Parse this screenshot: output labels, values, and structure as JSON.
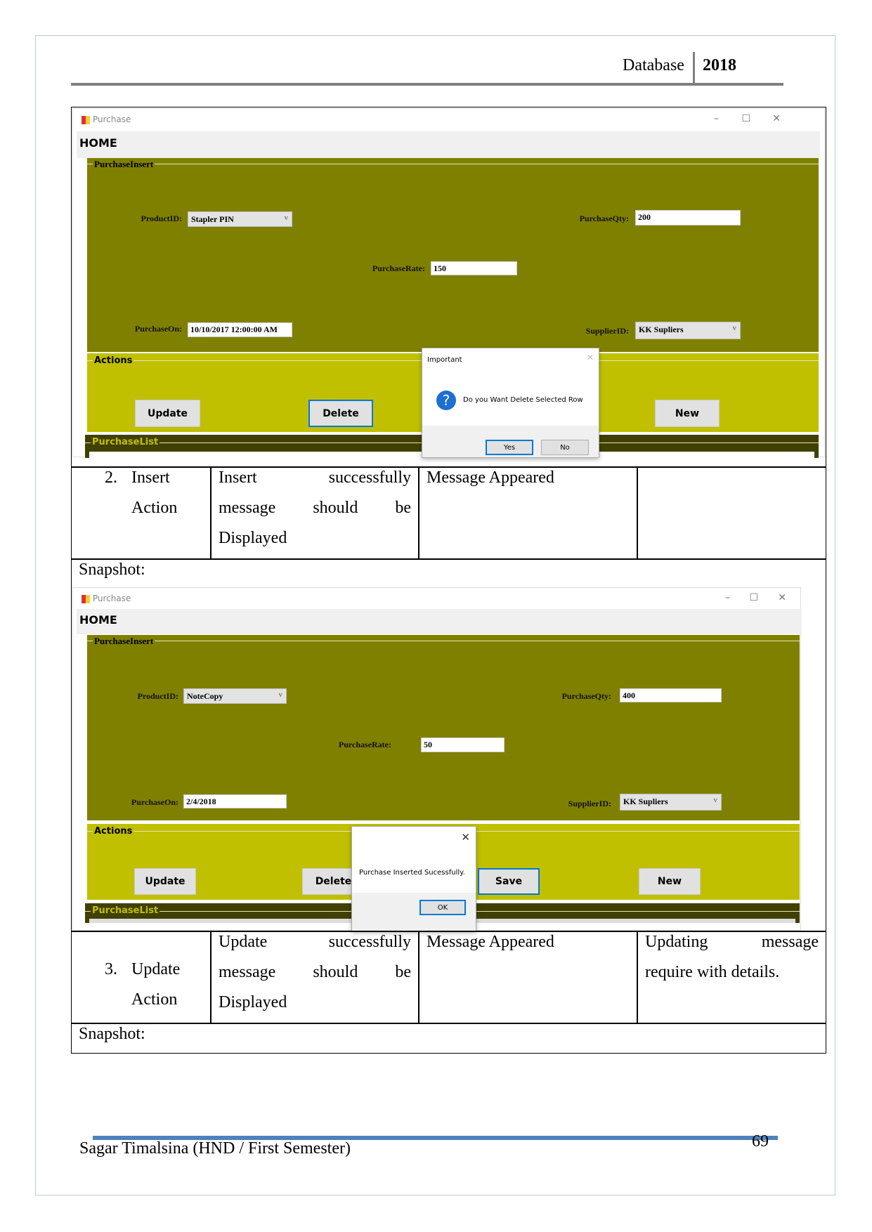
{
  "header": {
    "subject": "Database",
    "year": "2018"
  },
  "screens": [
    {
      "title": "Purchase",
      "home": "HOME",
      "group_insert": "PurchaseInsert",
      "group_actions": "Actions",
      "group_list": "PurchaseList",
      "labels": {
        "product": "ProductID:",
        "qty": "PurchaseQty:",
        "rate": "PurchaseRate:",
        "on": "PurchaseOn:",
        "supplier": "SupplierID:"
      },
      "values": {
        "product": "Stapler PIN",
        "qty": "200",
        "rate": "150",
        "on": "10/10/2017 12:00:00 AM",
        "supplier": "KK Supliers"
      },
      "buttons": {
        "update": "Update",
        "delete": "Delete",
        "new": "New"
      },
      "dialog": {
        "title": "Important",
        "message": "Do you Want Delete Selected Row",
        "yes": "Yes",
        "no": "No"
      }
    },
    {
      "title": "Purchase",
      "home": "HOME",
      "group_insert": "PurchaseInsert",
      "group_actions": "Actions",
      "group_list": "PurchaseList",
      "labels": {
        "product": "ProductID:",
        "qty": "PurchaseQty:",
        "rate": "PurchaseRate:",
        "on": "PurchaseOn:",
        "supplier": "SupplierID:"
      },
      "values": {
        "product": "NoteCopy",
        "qty": "400",
        "rate": "50",
        "on": "2/4/2018",
        "supplier": "KK Supliers"
      },
      "buttons": {
        "update": "Update",
        "delete": "Delete",
        "save": "Save",
        "new": "New"
      },
      "dialog": {
        "message": "Purchase Inserted Sucessfully.",
        "ok": "OK"
      }
    }
  ],
  "rows": [
    {
      "num": "2.",
      "test": [
        "Insert",
        "Action"
      ],
      "expected": [
        [
          "Insert",
          "successfully"
        ],
        [
          "message",
          "should",
          "be"
        ],
        [
          "Displayed"
        ]
      ],
      "actual": "Message Appeared",
      "remarks": []
    },
    {
      "num": "3.",
      "test": [
        "Update",
        "Action"
      ],
      "expected": [
        [
          "Update",
          "successfully"
        ],
        [
          "message",
          "should",
          "be"
        ],
        [
          "Displayed"
        ]
      ],
      "actual": "Message Appeared",
      "remarks": [
        [
          "Updating",
          "message"
        ],
        [
          "require with details."
        ]
      ]
    }
  ],
  "snapshot_label": "Snapshot:",
  "footer": {
    "author": "Sagar Timalsina (HND / First Semester)",
    "page": "69"
  },
  "colors": {
    "olive": "#808000",
    "lime": "#c0c000",
    "dark_olive": "#404000",
    "footer_line": "#4f81bd"
  }
}
